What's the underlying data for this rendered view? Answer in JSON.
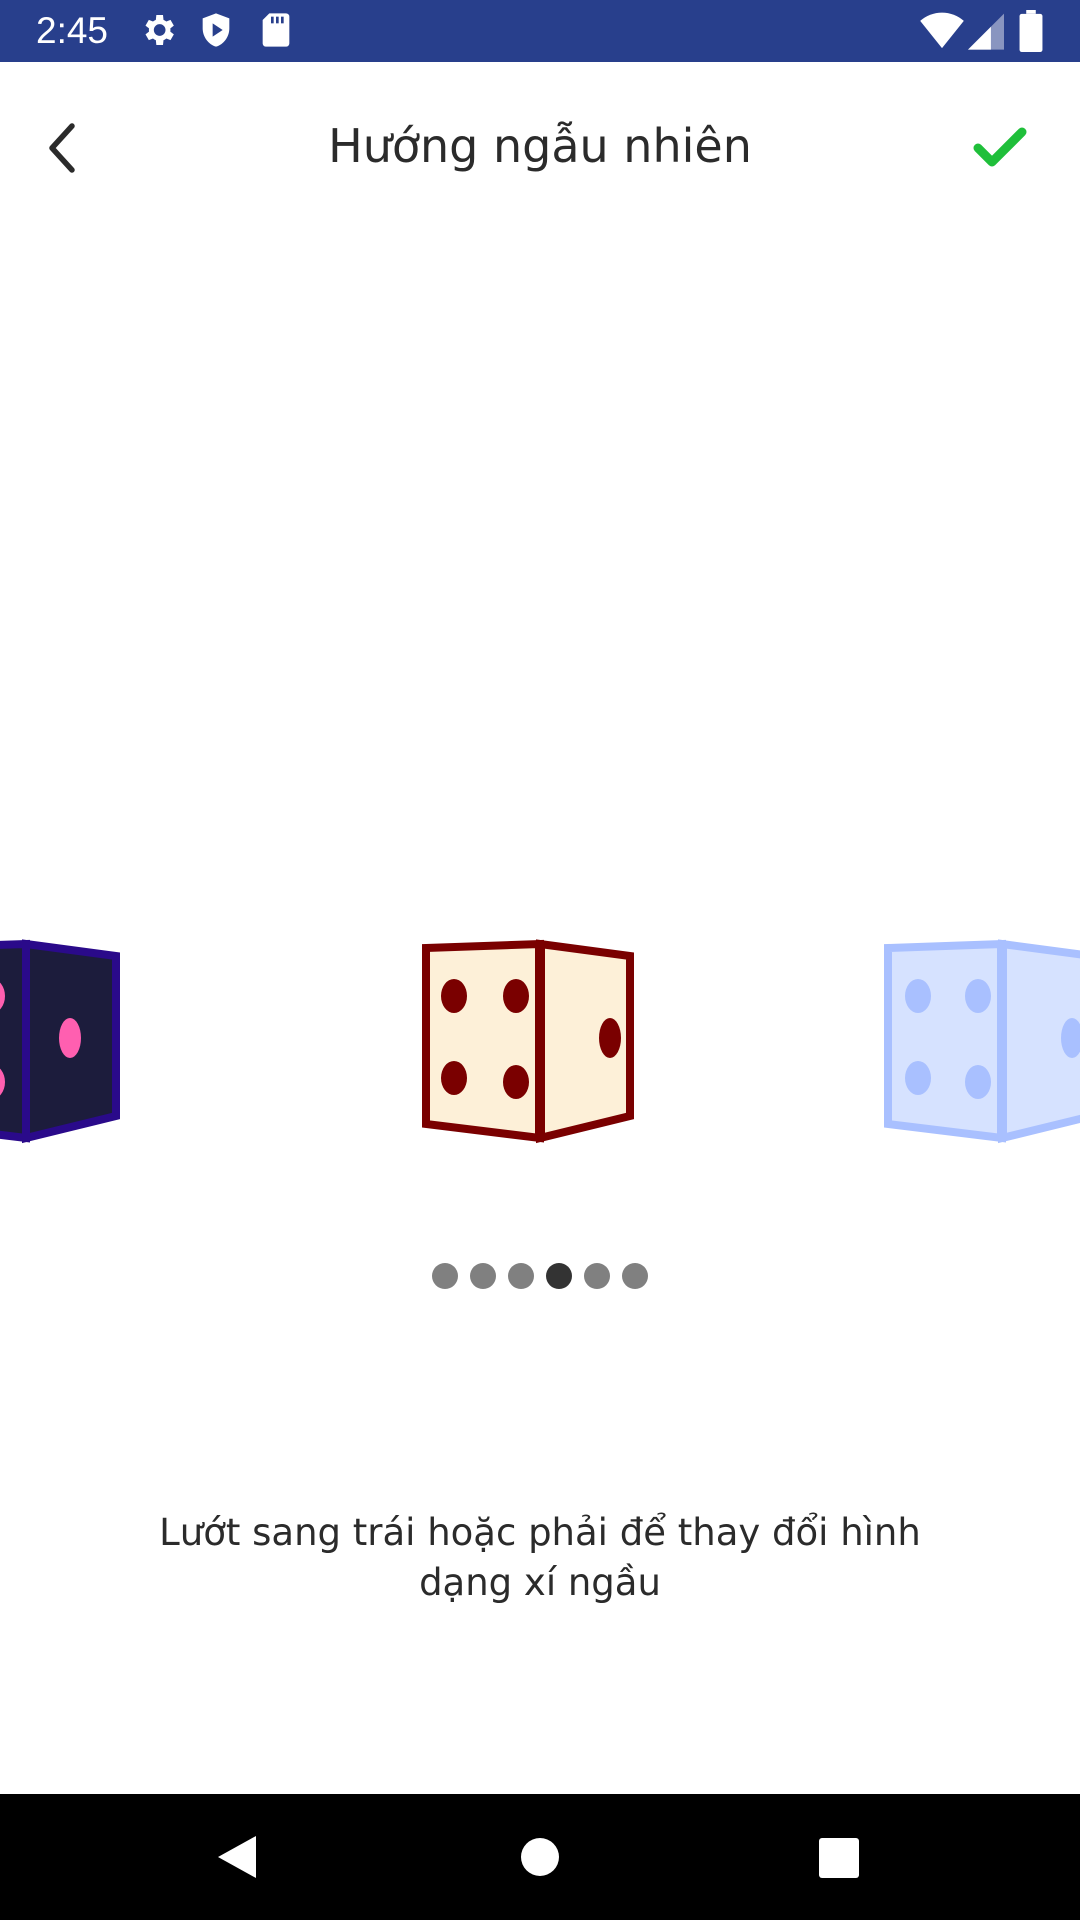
{
  "status_bar": {
    "time": "2:45",
    "icons": [
      "gear-icon",
      "shield-play-icon",
      "sd-card-icon",
      "wifi-icon",
      "signal-icon",
      "battery-icon"
    ],
    "background": "#283f8c"
  },
  "app_bar": {
    "title": "Hướng ngẫu nhiên",
    "back_icon": "chevron-left-icon",
    "confirm_icon": "checkmark-icon",
    "confirm_color": "#1fbf3a"
  },
  "carousel": {
    "dice": [
      {
        "name": "navy-pink-die",
        "face_color": "#1c1c3c",
        "edge_color": "#2a0a8a",
        "pip_color": "#ff5fb0"
      },
      {
        "name": "cream-maroon-die",
        "face_color": "#fdf0d8",
        "edge_color": "#7a0000",
        "pip_color": "#7a0000"
      },
      {
        "name": "light-blue-die",
        "face_color": "#d6e2ff",
        "edge_color": "#a9c0ff",
        "pip_color": "#a9c0ff"
      }
    ],
    "page_count": 6,
    "active_index": 3
  },
  "hint": {
    "line1": "Lướt sang trái hoặc phải để thay đổi hình",
    "line2": "dạng xí ngầu"
  },
  "nav_bar": {
    "back_icon": "triangle-back-icon",
    "home_icon": "circle-home-icon",
    "recents_icon": "square-recents-icon"
  }
}
